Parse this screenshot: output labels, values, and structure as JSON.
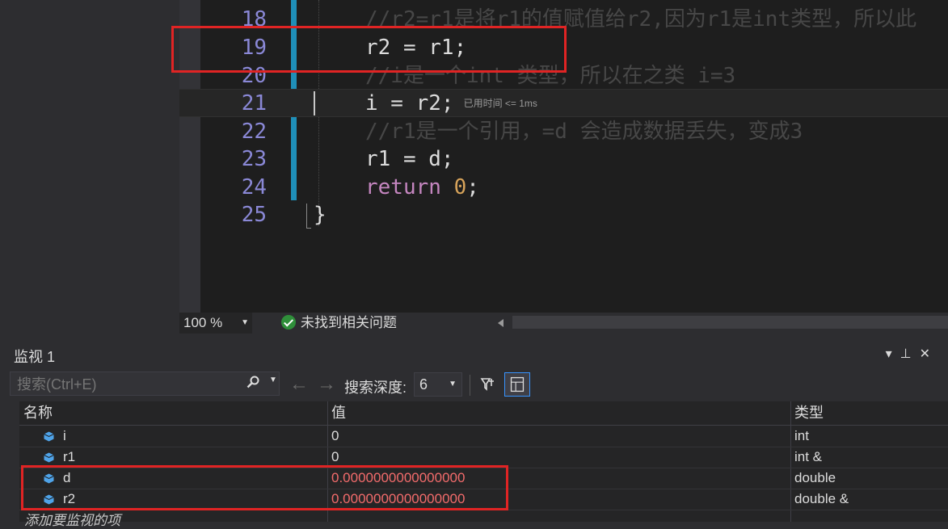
{
  "editor": {
    "lines": [
      {
        "num": "18",
        "kind": "comment",
        "text": "//r2=r1是将r1的值赋值给r2,因为r1是int类型，所以此"
      },
      {
        "num": "19",
        "kind": "code",
        "text": "r2 = r1;"
      },
      {
        "num": "20",
        "kind": "comment",
        "text": "//i是一个int 类型，所以在之类 i=3"
      },
      {
        "num": "21",
        "kind": "code",
        "text": "i = r2;",
        "hint": "已用时间 <= 1ms"
      },
      {
        "num": "22",
        "kind": "comment",
        "text": "//r1是一个引用，=d 会造成数据丢失，变成3"
      },
      {
        "num": "23",
        "kind": "code",
        "text": "r1 = d;"
      },
      {
        "num": "24",
        "kind": "return",
        "keyword": "return",
        "value": "0",
        "end": ";"
      },
      {
        "num": "25",
        "kind": "brace",
        "text": "}"
      }
    ]
  },
  "status": {
    "zoom": "100 %",
    "issues": "未找到相关问题"
  },
  "watch": {
    "title": "监视 1",
    "search_placeholder": "搜索(Ctrl+E)",
    "depth_label": "搜索深度:",
    "depth_value": "6",
    "columns": {
      "name": "名称",
      "value": "值",
      "type": "类型"
    },
    "rows": [
      {
        "name": "i",
        "value": "0",
        "type": "int",
        "changed": false
      },
      {
        "name": "r1",
        "value": "0",
        "type": "int &",
        "changed": false
      },
      {
        "name": "d",
        "value": "0.0000000000000000",
        "type": "double",
        "changed": true
      },
      {
        "name": "r2",
        "value": "0.0000000000000000",
        "type": "double &",
        "changed": true
      }
    ],
    "add_item": "添加要监视的项"
  },
  "colors": {
    "highlight_box": "#e02424",
    "changed_value": "#f26b6b",
    "line_number": "#8a88d6",
    "change_bar": "#1f8fb8"
  }
}
